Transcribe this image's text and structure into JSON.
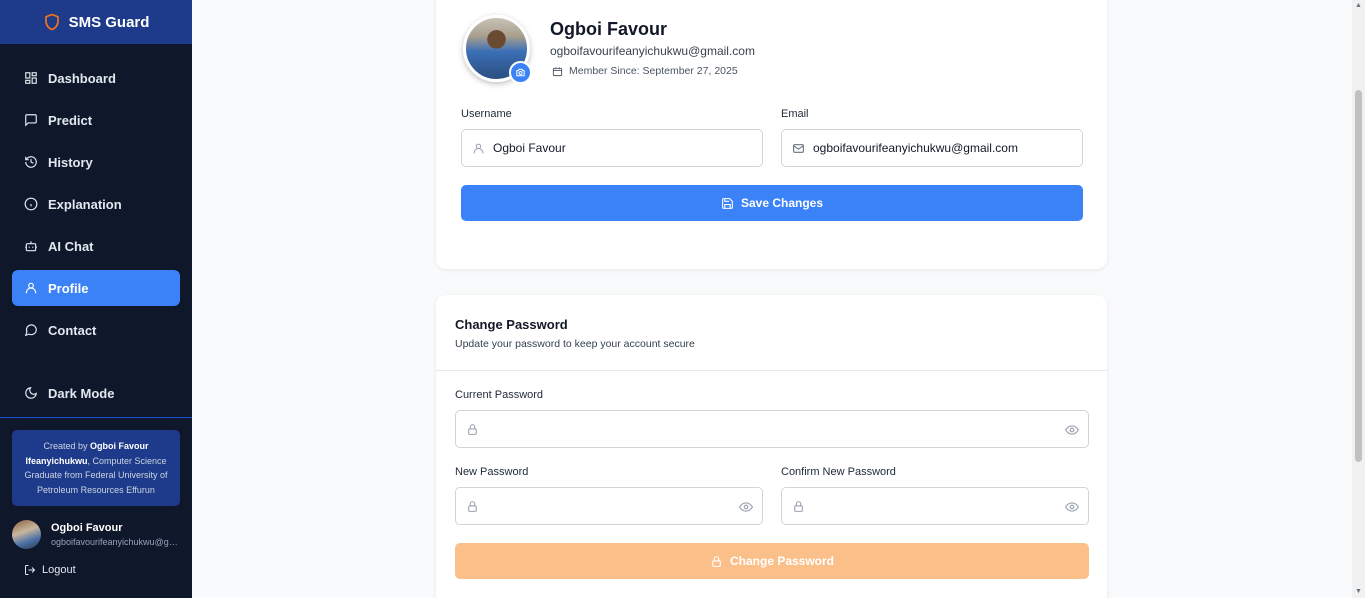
{
  "brand": {
    "name": "SMS Guard",
    "logo_icon": "shield-icon"
  },
  "sidebar": {
    "items": [
      {
        "label": "Dashboard",
        "icon": "grid-icon",
        "active": false
      },
      {
        "label": "Predict",
        "icon": "chat-icon",
        "active": false
      },
      {
        "label": "History",
        "icon": "history-icon",
        "active": false
      },
      {
        "label": "Explanation",
        "icon": "info-icon",
        "active": false
      },
      {
        "label": "AI Chat",
        "icon": "robot-icon",
        "active": false
      },
      {
        "label": "Profile",
        "icon": "user-icon",
        "active": true
      },
      {
        "label": "Contact",
        "icon": "message-circle-icon",
        "active": false
      }
    ],
    "dark_mode_label": "Dark Mode",
    "credit_prefix": "Created by ",
    "credit_name": "Ogboi Favour Ifeanyichukwu",
    "credit_suffix": ", Computer Science Graduate from Federal University of Petroleum Resources Effurun",
    "user_name": "Ogboi Favour",
    "user_email": "ogboifavourifeanyichukwu@gmail.com",
    "logout_label": "Logout"
  },
  "profile": {
    "name": "Ogboi Favour",
    "email": "ogboifavourifeanyichukwu@gmail.com",
    "member_since": "Member Since: September 27, 2025",
    "username_label": "Username",
    "username_value": "Ogboi Favour",
    "email_label": "Email",
    "email_value": "ogboifavourifeanyichukwu@gmail.com",
    "save_label": "Save Changes"
  },
  "change_password": {
    "title": "Change Password",
    "subtitle": "Update your password to keep your account secure",
    "current_label": "Current Password",
    "new_label": "New Password",
    "confirm_label": "Confirm New Password",
    "button_label": "Change Password"
  },
  "colors": {
    "accent": "#3b82f6",
    "sidebar_bg": "#0f172a",
    "brand_bg": "#1e3a8a",
    "disabled_btn": "#fbbf8a"
  }
}
